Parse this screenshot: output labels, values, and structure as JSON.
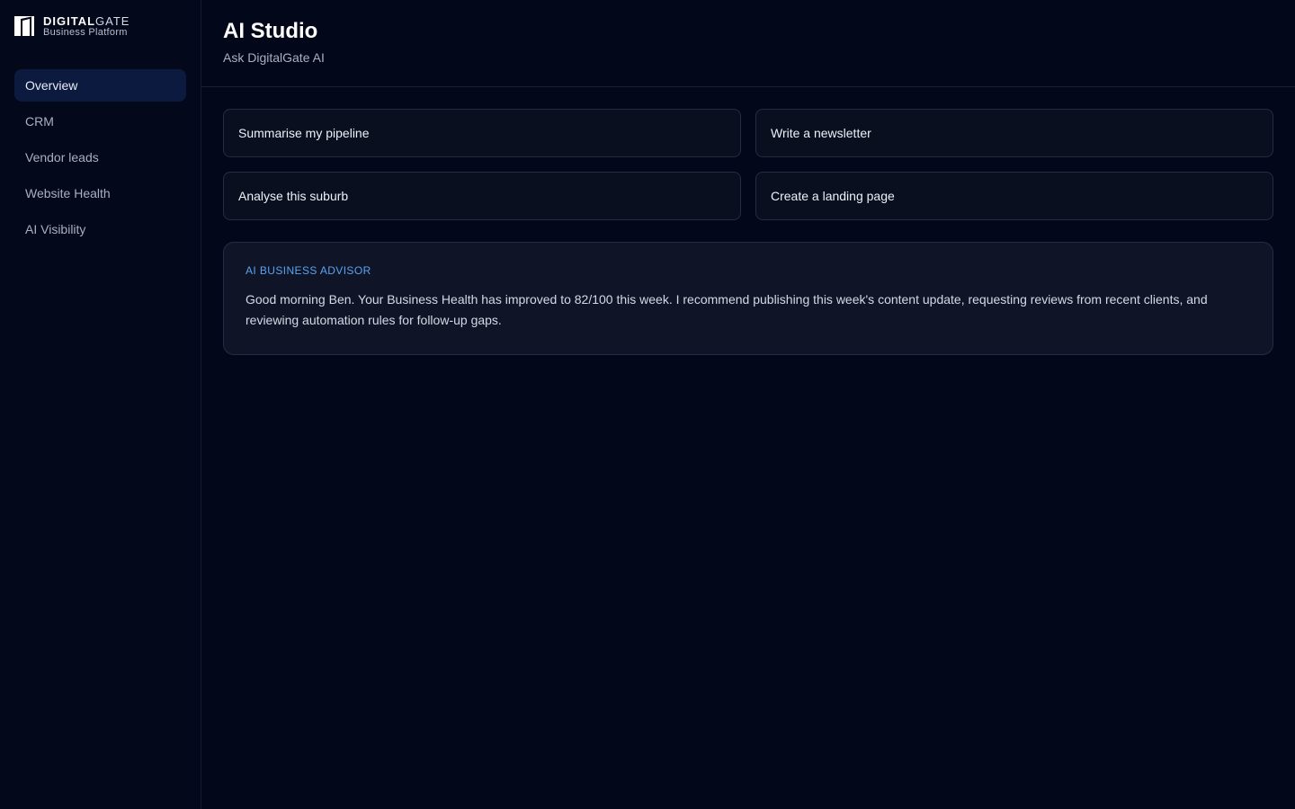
{
  "brand": {
    "name_strong": "DIGITAL",
    "name_light": "GATE",
    "subtitle": "Business Platform"
  },
  "sidebar": {
    "items": [
      {
        "label": "Overview",
        "active": true
      },
      {
        "label": "CRM",
        "active": false
      },
      {
        "label": "Vendor leads",
        "active": false
      },
      {
        "label": "Website Health",
        "active": false
      },
      {
        "label": "AI Visibility",
        "active": false
      }
    ]
  },
  "header": {
    "title": "AI Studio",
    "subtitle": "Ask DigitalGate AI"
  },
  "actions": [
    {
      "label": "Summarise my pipeline"
    },
    {
      "label": "Write a newsletter"
    },
    {
      "label": "Analyse this suburb"
    },
    {
      "label": "Create a landing page"
    }
  ],
  "advisor": {
    "label": "AI BUSINESS ADVISOR",
    "message": "Good morning Ben. Your Business Health has improved to 82/100 this week. I recommend publishing this week's content update, requesting reviews from recent clients, and reviewing automation rules for follow-up gaps."
  },
  "colors": {
    "background": "#03071a",
    "active_nav": "#0c1a40",
    "accent": "#5aa2f0"
  },
  "icons": {
    "brand": "door-logo-icon"
  }
}
